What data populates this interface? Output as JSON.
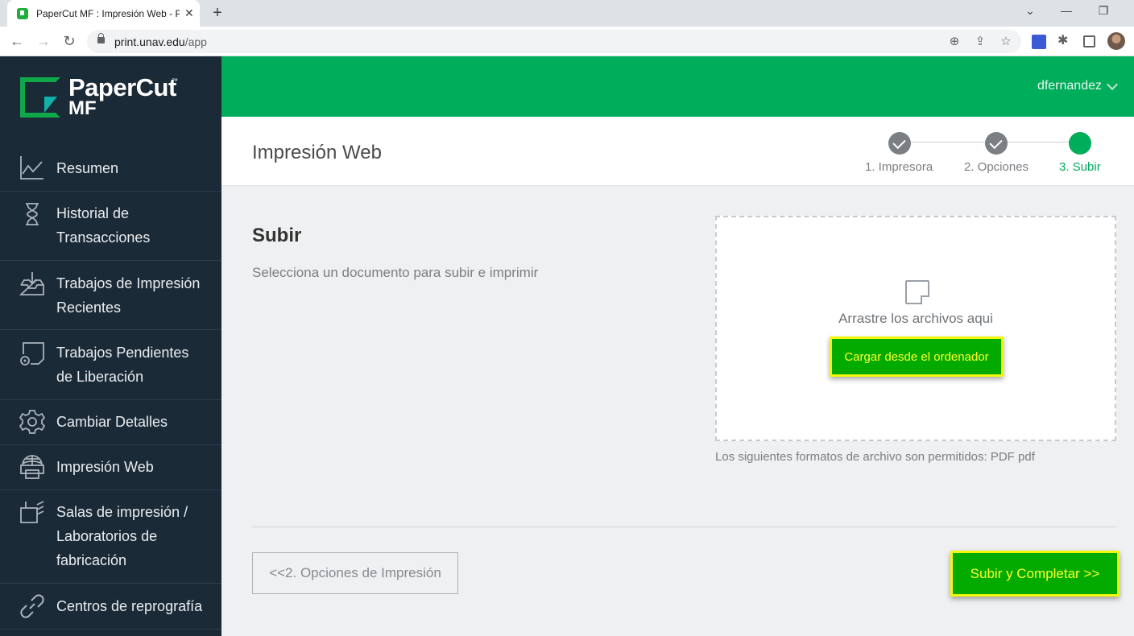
{
  "browser": {
    "tab_title": "PaperCut MF : Impresión Web - P",
    "url_host": "print.unav.edu",
    "url_path": "/app"
  },
  "sidebar": {
    "logo_text": "PaperCut",
    "logo_sub": "MF",
    "logo_tm": "™",
    "items": [
      {
        "label": "Resumen",
        "icon": "chart-line-icon"
      },
      {
        "label": "Historial de Transacciones",
        "icon": "hourglass-icon"
      },
      {
        "label": "Trabajos de Impresión Recientes",
        "icon": "inbox-tray-icon"
      },
      {
        "label": "Trabajos Pendientes de Liberación",
        "icon": "document-release-icon"
      },
      {
        "label": "Cambiar Detalles",
        "icon": "gear-icon"
      },
      {
        "label": "Impresión Web",
        "icon": "globe-printer-icon"
      },
      {
        "label": "Salas de impresión / Laboratorios de fabricación",
        "icon": "lab-flag-icon"
      },
      {
        "label": "Centros de reprografía",
        "icon": "link-chain-icon"
      }
    ]
  },
  "topbar": {
    "username": "dfernandez"
  },
  "header": {
    "page_title": "Impresión Web",
    "steps": [
      {
        "label": "1. Impresora",
        "state": "done"
      },
      {
        "label": "2. Opciones",
        "state": "done"
      },
      {
        "label": "3. Subir",
        "state": "active"
      }
    ]
  },
  "main": {
    "section_title": "Subir",
    "section_desc": "Selecciona un documento para subir e imprimir",
    "drop_text": "Arrastre los archivos aqui",
    "upload_button": "Cargar desde el ordenador",
    "formats_text": "Los siguientes formatos de archivo son permitidos: PDF pdf",
    "back_button": "<<2. Opciones de Impresión",
    "submit_button": "Subir y Completar >>"
  },
  "colors": {
    "brand_green": "#00ad5b",
    "sidebar_bg": "#1b2a37",
    "highlight_yellow": "#f3f70a",
    "button_green": "#03aa00"
  }
}
